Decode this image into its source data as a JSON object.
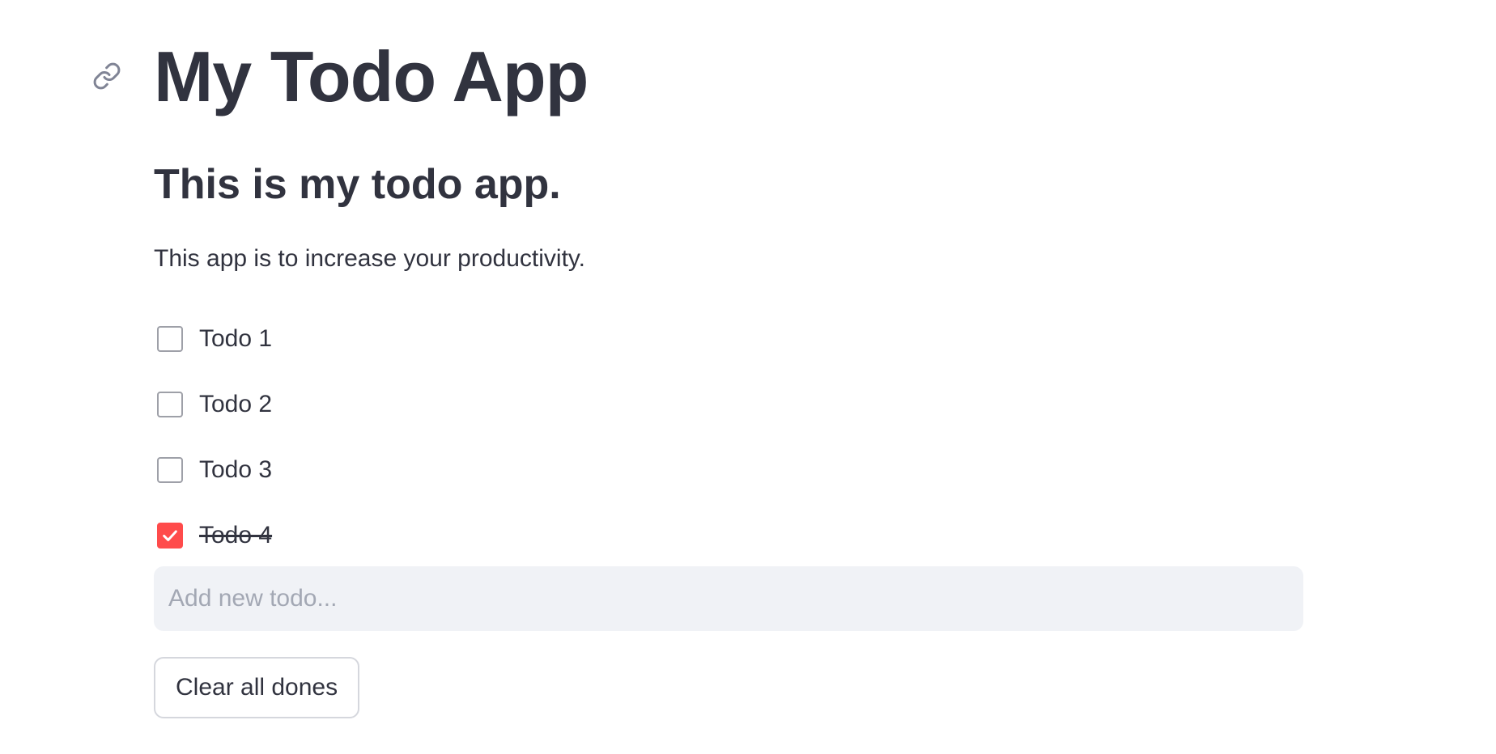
{
  "header": {
    "title": "My Todo App",
    "anchor_icon": "link-icon"
  },
  "main": {
    "subtitle": "This is my todo app.",
    "description": "This app is to increase your productivity."
  },
  "todos": [
    {
      "label": "Todo 1",
      "done": false
    },
    {
      "label": "Todo 2",
      "done": false
    },
    {
      "label": "Todo 3",
      "done": false
    },
    {
      "label": "Todo 4",
      "done": true
    }
  ],
  "new_todo": {
    "value": "",
    "placeholder": "Add new todo..."
  },
  "actions": {
    "clear_label": "Clear all dones"
  },
  "colors": {
    "accent": "#ff4b4b",
    "text": "#31333f",
    "input_bg": "#f0f2f6",
    "checkbox_border": "#9ea0a8",
    "button_border": "#d5d7dd"
  }
}
